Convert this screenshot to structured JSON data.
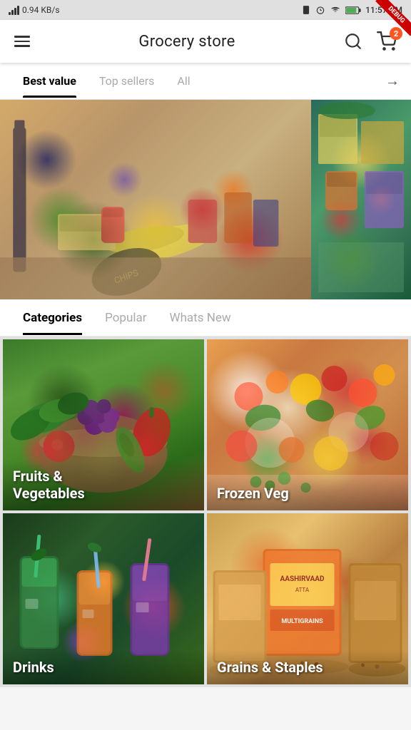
{
  "statusBar": {
    "network": "0.94 KB/s",
    "time": "11:57 AM",
    "batteryIcon": "battery-icon",
    "wifiIcon": "wifi-icon",
    "alarmIcon": "alarm-icon",
    "phoneIcon": "phone-icon"
  },
  "appBar": {
    "title": "Grocery store",
    "cartBadge": "2",
    "menuIcon": "menu-icon",
    "searchIcon": "search-icon",
    "cartIcon": "cart-icon"
  },
  "valueTabs": {
    "items": [
      {
        "label": "Best value",
        "active": true
      },
      {
        "label": "Top sellers",
        "active": false
      },
      {
        "label": "All",
        "active": false
      }
    ],
    "arrowIcon": "arrow-right-icon"
  },
  "categoryTabs": {
    "items": [
      {
        "label": "Categories",
        "active": true
      },
      {
        "label": "Popular",
        "active": false
      },
      {
        "label": "Whats New",
        "active": false
      }
    ]
  },
  "categoryCards": [
    {
      "id": "fruits-veg",
      "label": "Fruits &\nVegetables"
    },
    {
      "id": "frozen-veg",
      "label": "Frozen Veg"
    },
    {
      "id": "drinks",
      "label": "Drinks"
    },
    {
      "id": "grains",
      "label": "Grains & Staples"
    }
  ],
  "debug": {
    "label": "DEBUG"
  }
}
